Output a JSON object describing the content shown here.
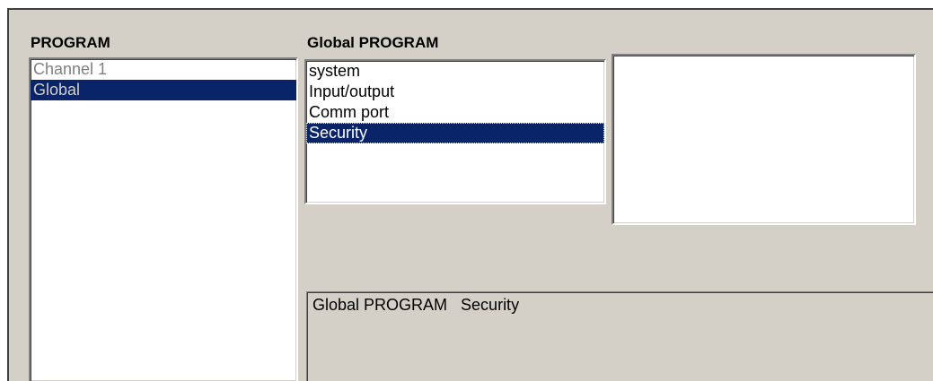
{
  "program": {
    "heading": "PROGRAM",
    "items": [
      {
        "label": "Channel 1"
      },
      {
        "label": "Global",
        "selected": true
      }
    ]
  },
  "global_program": {
    "heading": "Global PROGRAM",
    "items": [
      {
        "label": "system"
      },
      {
        "label": "Input/output"
      },
      {
        "label": "Comm port"
      },
      {
        "label": "Security",
        "selected": true
      }
    ]
  },
  "status": {
    "text": "Global PROGRAM   Security"
  },
  "colors": {
    "selection": "#0a246a",
    "panel": "#d4d0c8"
  }
}
